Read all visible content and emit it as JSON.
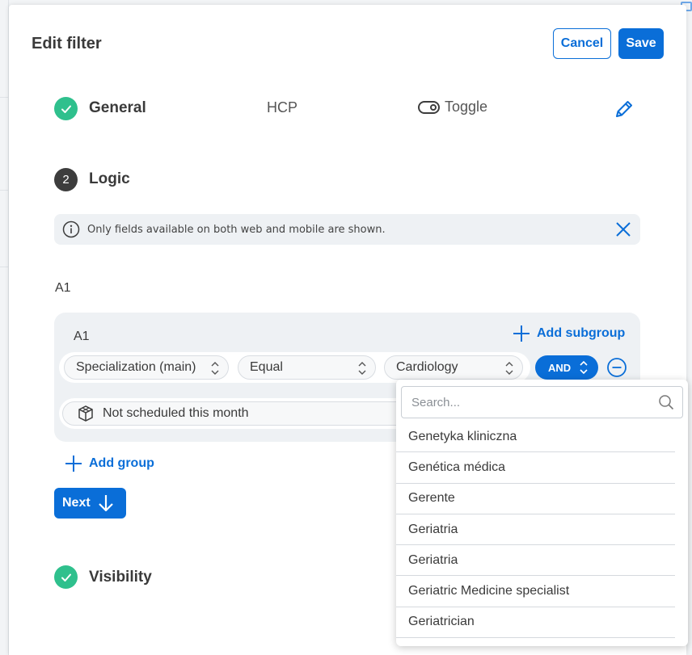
{
  "dialog": {
    "title": "Edit filter",
    "cancel_label": "Cancel",
    "save_label": "Save"
  },
  "steps": {
    "general": {
      "label": "General",
      "value": "HCP",
      "type_label": "Toggle"
    },
    "logic": {
      "number": "2",
      "label": "Logic"
    },
    "visibility": {
      "label": "Visibility"
    }
  },
  "info": {
    "message": "Only fields available on both web and mobile are shown."
  },
  "logic_editor": {
    "outer_label": "A1",
    "group_label": "A1",
    "add_subgroup_label": "Add subgroup",
    "rule": {
      "field": "Specialization (main)",
      "operator": "Equal",
      "value": "Cardiology",
      "connector": "AND"
    },
    "rule2": {
      "label": "Not scheduled this month"
    },
    "add_group_label": "Add group",
    "next_label": "Next"
  },
  "dropdown": {
    "search_placeholder": "Search...",
    "options": [
      "Genetyka kliniczna",
      "Genética médica",
      "Gerente",
      "Geriatria",
      "Geriatria",
      "Geriatric Medicine specialist",
      "Geriatrician"
    ]
  },
  "colors": {
    "accent": "#0a6ed8",
    "success": "#2fc08d",
    "panel": "#eef1f4"
  }
}
